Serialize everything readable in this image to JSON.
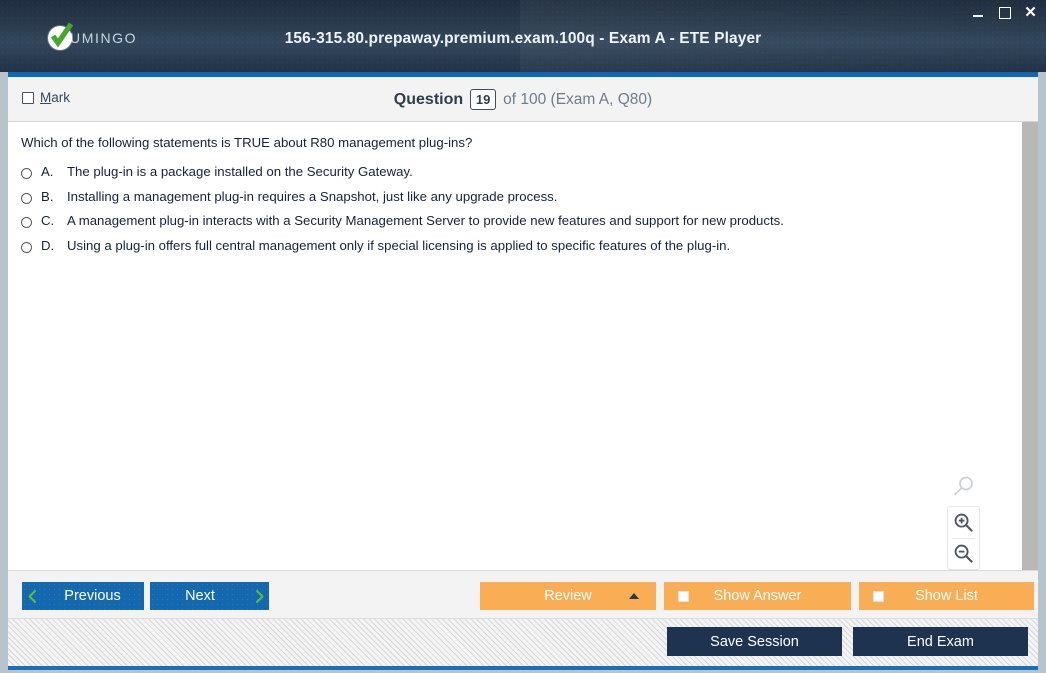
{
  "window": {
    "title": "156-315.80.prepaway.premium.exam.100q - Exam A - ETE Player",
    "logo_text": "UMINGO",
    "controls": {
      "minimize": "_",
      "maximize": "□",
      "close": "✕"
    },
    "accent_color": "#1068b3"
  },
  "question_header": {
    "mark_label_prefix": "M",
    "mark_label_rest": "ark",
    "question_word": "Question",
    "question_number": "19",
    "of_text": "of 100 (Exam A, Q80)"
  },
  "question": {
    "text": "Which of the following statements is TRUE about R80 management plug-ins?",
    "options": [
      {
        "letter": "A.",
        "text": "The plug-in is a package installed on the Security Gateway.",
        "selected": false
      },
      {
        "letter": "B.",
        "text": "Installing a management plug-in requires a Snapshot, just like any upgrade process.",
        "selected": false
      },
      {
        "letter": "C.",
        "text": "A management plug-in interacts with a Security Management Server to provide new features and support for new products.",
        "selected": false
      },
      {
        "letter": "D.",
        "text": "Using a plug-in offers full central management only if special licensing is applied to specific features of the plug-in.",
        "selected": false
      }
    ]
  },
  "zoom_controls": {
    "ghost_icon": "magnifier-icon",
    "zoom_in_icon": "zoom-in-icon",
    "zoom_out_icon": "zoom-out-icon"
  },
  "toolbar": {
    "previous_label": "Previous",
    "next_label": "Next",
    "review_label": "Review",
    "show_answer_label": "Show Answer",
    "show_list_label": "Show List",
    "nav_button_color": "#1468ad",
    "action_button_color": "#f9ad55"
  },
  "footer": {
    "save_session_label": "Save Session",
    "end_exam_label": "End Exam",
    "button_color": "#1d3350"
  }
}
